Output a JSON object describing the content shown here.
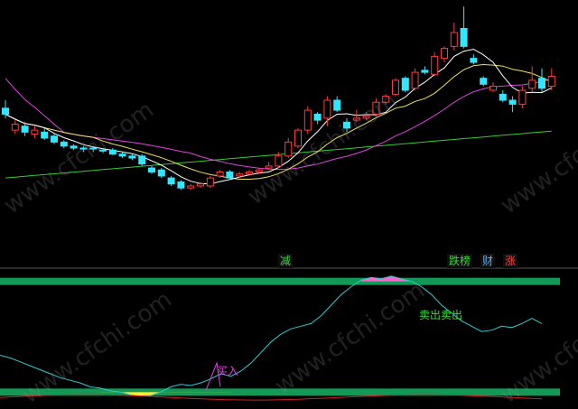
{
  "watermark": "www.cfchi.com",
  "tags": [
    {
      "text": "减",
      "color": "#33dd33"
    },
    {
      "text": "跌榜",
      "color": "#33dd33"
    },
    {
      "text": "财",
      "color": "#4fb0ff"
    },
    {
      "text": "涨",
      "color": "#ff4040"
    }
  ],
  "signals": {
    "buy": "买入",
    "sell": "卖出卖出"
  },
  "colors": {
    "up": "#ff3b3b",
    "down": "#33e6ff",
    "band": "#119955",
    "ma5": "#ffffff",
    "ma10": "#f0e060",
    "ma20": "#e040e0",
    "ma60": "#33cc33",
    "osc": "#30c8d0",
    "fill_low": "#ffee33",
    "fill_high": "#ff66cc"
  },
  "chart_data": {
    "type": "candlestick",
    "ylim": [
      0,
      100
    ],
    "candles": [
      {
        "o": 63,
        "c": 60,
        "h": 67,
        "l": 58
      },
      {
        "o": 52,
        "c": 55,
        "h": 57,
        "l": 50
      },
      {
        "o": 54,
        "c": 51,
        "h": 56,
        "l": 49
      },
      {
        "o": 50,
        "c": 52,
        "h": 54,
        "l": 48
      },
      {
        "o": 51,
        "c": 48,
        "h": 53,
        "l": 47
      },
      {
        "o": 49,
        "c": 46,
        "h": 50,
        "l": 45
      },
      {
        "o": 46,
        "c": 44,
        "h": 47,
        "l": 43
      },
      {
        "o": 44,
        "c": 43,
        "h": 45,
        "l": 42
      },
      {
        "o": 43,
        "c": 42.5,
        "h": 44,
        "l": 41
      },
      {
        "o": 43,
        "c": 42.5,
        "h": 44,
        "l": 41
      },
      {
        "o": 42,
        "c": 41.5,
        "h": 43,
        "l": 40.5
      },
      {
        "o": 42,
        "c": 40,
        "h": 43,
        "l": 39.5
      },
      {
        "o": 40,
        "c": 39,
        "h": 41,
        "l": 38
      },
      {
        "o": 39,
        "c": 38,
        "h": 40,
        "l": 37
      },
      {
        "o": 39,
        "c": 35,
        "h": 40,
        "l": 34
      },
      {
        "o": 33,
        "c": 31,
        "h": 34,
        "l": 30
      },
      {
        "o": 32,
        "c": 29,
        "h": 33,
        "l": 28
      },
      {
        "o": 28,
        "c": 25,
        "h": 29,
        "l": 24
      },
      {
        "o": 26,
        "c": 23,
        "h": 27,
        "l": 22
      },
      {
        "o": 23,
        "c": 24,
        "h": 25,
        "l": 22
      },
      {
        "o": 24,
        "c": 25,
        "h": 26,
        "l": 23
      },
      {
        "o": 24,
        "c": 28,
        "h": 29,
        "l": 23
      },
      {
        "o": 29,
        "c": 31,
        "h": 32,
        "l": 28
      },
      {
        "o": 31,
        "c": 28,
        "h": 32,
        "l": 27
      },
      {
        "o": 29,
        "c": 30,
        "h": 31,
        "l": 28
      },
      {
        "o": 30,
        "c": 31,
        "h": 32,
        "l": 29
      },
      {
        "o": 31,
        "c": 32,
        "h": 33,
        "l": 30
      },
      {
        "o": 33,
        "c": 34,
        "h": 36,
        "l": 32
      },
      {
        "o": 34,
        "c": 39,
        "h": 41,
        "l": 33
      },
      {
        "o": 39,
        "c": 46,
        "h": 48,
        "l": 38
      },
      {
        "o": 44,
        "c": 52,
        "h": 53,
        "l": 43
      },
      {
        "o": 52,
        "c": 62,
        "h": 64,
        "l": 50
      },
      {
        "o": 60,
        "c": 57,
        "h": 61,
        "l": 55
      },
      {
        "o": 58,
        "c": 67,
        "h": 69,
        "l": 54
      },
      {
        "o": 67,
        "c": 62,
        "h": 69,
        "l": 61
      },
      {
        "o": 56,
        "c": 53,
        "h": 58,
        "l": 51
      },
      {
        "o": 57,
        "c": 58,
        "h": 62,
        "l": 56
      },
      {
        "o": 58,
        "c": 59,
        "h": 61,
        "l": 57
      },
      {
        "o": 60,
        "c": 66,
        "h": 68,
        "l": 59
      },
      {
        "o": 66,
        "c": 69,
        "h": 70,
        "l": 65
      },
      {
        "o": 70,
        "c": 77,
        "h": 78,
        "l": 69
      },
      {
        "o": 78,
        "c": 72,
        "h": 79,
        "l": 71
      },
      {
        "o": 73,
        "c": 81,
        "h": 83,
        "l": 72
      },
      {
        "o": 82,
        "c": 81,
        "h": 84,
        "l": 80
      },
      {
        "o": 80,
        "c": 89,
        "h": 91,
        "l": 79
      },
      {
        "o": 88,
        "c": 93,
        "h": 94,
        "l": 86
      },
      {
        "o": 94,
        "c": 101,
        "h": 106,
        "l": 92
      },
      {
        "o": 103,
        "c": 94,
        "h": 114,
        "l": 93
      },
      {
        "o": 88,
        "c": 86,
        "h": 90,
        "l": 85
      },
      {
        "o": 78,
        "c": 75,
        "h": 79,
        "l": 74
      },
      {
        "o": 72,
        "c": 74,
        "h": 76,
        "l": 71
      },
      {
        "o": 70,
        "c": 67,
        "h": 72,
        "l": 66
      },
      {
        "o": 67,
        "c": 65,
        "h": 69,
        "l": 61
      },
      {
        "o": 65,
        "c": 72,
        "h": 74,
        "l": 63
      },
      {
        "o": 73,
        "c": 77,
        "h": 84,
        "l": 71
      },
      {
        "o": 78,
        "c": 73,
        "h": 83,
        "l": 71
      },
      {
        "o": 74,
        "c": 79,
        "h": 83,
        "l": 72
      }
    ],
    "oscillator": {
      "ylim": [
        0,
        100
      ],
      "band_low": 8,
      "band_high": 92
    }
  }
}
